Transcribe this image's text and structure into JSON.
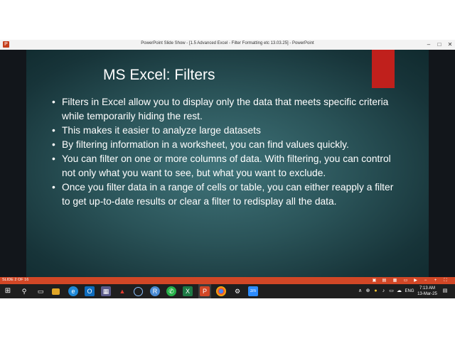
{
  "window": {
    "title": "PowerPoint Slide Show - [1.5 Advanced Excel - Filter Formatting etc 13.03.25] - PowerPoint",
    "minimize_icon": "minimize-icon",
    "maximize_icon": "maximize-icon",
    "close_icon": "close-icon"
  },
  "slide": {
    "title": "MS Excel: Filters",
    "accent_color": "#c0201c",
    "bullets": [
      "Filters in Excel allow you to display only the data that meets specific criteria while temporarily hiding the rest.",
      "This makes it easier to analyze large datasets",
      "By filtering information in a worksheet, you can find values quickly.",
      "You can filter on one or more columns of data. With filtering, you can control not only what you want to see, but what you want to exclude.",
      "Once you filter data in a range of cells or table, you can either reapply a filter to get up-to-date results or clear a filter to redisplay all the data."
    ]
  },
  "statusbar": {
    "slide_number": "SLIDE 2 OF 16",
    "color": "#d24726"
  },
  "taskbar": {
    "apps": [
      "windows-start-icon",
      "search-icon",
      "task-view-icon",
      "file-explorer-icon",
      "edge-icon",
      "outlook-icon",
      "calculator-icon",
      "acrobat-icon",
      "cortana-icon",
      "app-icon",
      "whatsapp-icon",
      "excel-icon",
      "powerpoint-icon",
      "chrome-icon",
      "settings-icon",
      "zoom-icon"
    ],
    "zoom_label": "zm",
    "language": "ENG",
    "time": "7:13 AM",
    "date": "13-Mar-25"
  }
}
